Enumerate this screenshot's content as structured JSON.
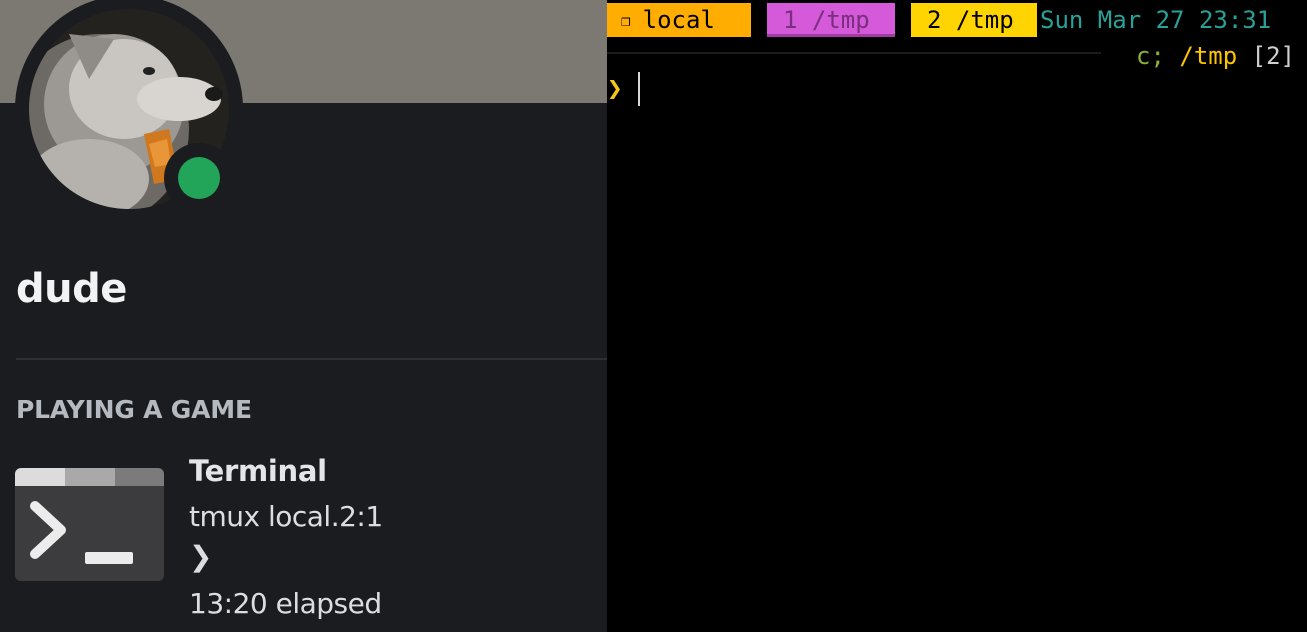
{
  "profile": {
    "username": "dude",
    "status": "online",
    "status_color": "#23a559",
    "activity_heading": "PLAYING A GAME",
    "game": {
      "name": "Terminal",
      "details": "tmux local.2:1",
      "state": "❯",
      "elapsed": "13:20 elapsed",
      "icon": "terminal-app-icon"
    }
  },
  "terminal": {
    "tabs": [
      {
        "label": "local",
        "icon": "❐",
        "color": "#ffad00"
      },
      {
        "label": "1 /tmp",
        "color": "#d45ad9"
      },
      {
        "label": "2 /tmp",
        "color": "#ffd400"
      }
    ],
    "clock": "Sun Mar 27 23:31",
    "pane_info": {
      "cmd": "c;",
      "path": "/tmp",
      "index": "[2]"
    },
    "prompt": "❯"
  }
}
